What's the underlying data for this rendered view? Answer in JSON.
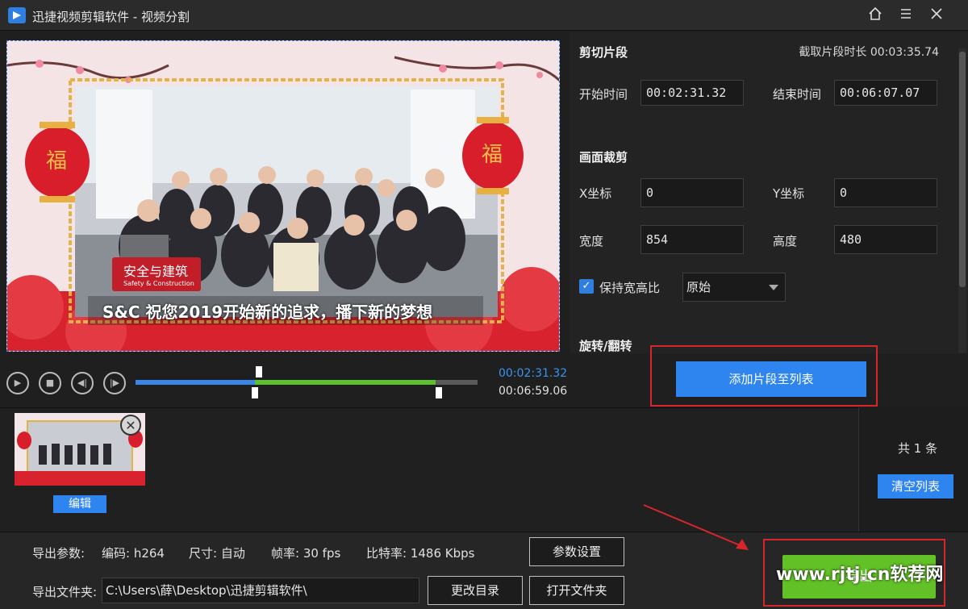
{
  "window": {
    "title": "迅捷视频剪辑软件 - 视频分割"
  },
  "icons": {
    "home": "home-icon",
    "menu": "menu-icon",
    "close": "close-icon"
  },
  "preview": {
    "caption": "S&C 祝您2019开始新的追求，播下新的梦想",
    "banner_cn": "安全与建筑",
    "banner_en": "Safety & Construction",
    "lantern_char": "福"
  },
  "clip": {
    "section_title": "剪切片段",
    "duration_label": "截取片段时长 00:03:35.74",
    "start_label": "开始时间",
    "start_value": "00:02:31.32",
    "end_label": "结束时间",
    "end_value": "00:06:07.07"
  },
  "crop": {
    "section_title": "画面裁剪",
    "x_label": "X坐标",
    "x_value": "0",
    "y_label": "Y坐标",
    "y_value": "0",
    "width_label": "宽度",
    "width_value": "854",
    "height_label": "高度",
    "height_value": "480",
    "keep_ratio_label": "保持宽高比",
    "keep_ratio_checked": true,
    "ratio_select": "原始"
  },
  "rotate": {
    "section_title": "旋转/翻转"
  },
  "playback": {
    "current_time": "00:02:31.32",
    "total_time": "00:06:59.06",
    "played_fraction": 0.349,
    "selection_start_fraction": 0.349,
    "selection_end_fraction": 0.877
  },
  "actions": {
    "add_segment": "添加片段至列表"
  },
  "list": {
    "edit_label": "编辑",
    "count_label": "共 1 条",
    "clear_label": "清空列表"
  },
  "export": {
    "params_label": "导出参数:",
    "codec": "编码: h264",
    "size": "尺寸: 自动",
    "fps": "帧率: 30 fps",
    "bitrate": "比特率: 1486 Kbps",
    "settings_button": "参数设置",
    "folder_label": "导出文件夹:",
    "folder_path": "C:\\Users\\薛\\Desktop\\迅捷剪辑软件\\",
    "change_dir_button": "更改目录",
    "open_folder_button": "打开文件夹",
    "export_button": "导出"
  },
  "watermark": "www.rjtj.cn软荐网",
  "colors": {
    "accent_blue": "#2f85f0",
    "accent_green": "#62c126",
    "highlight_red": "#d6262b"
  }
}
